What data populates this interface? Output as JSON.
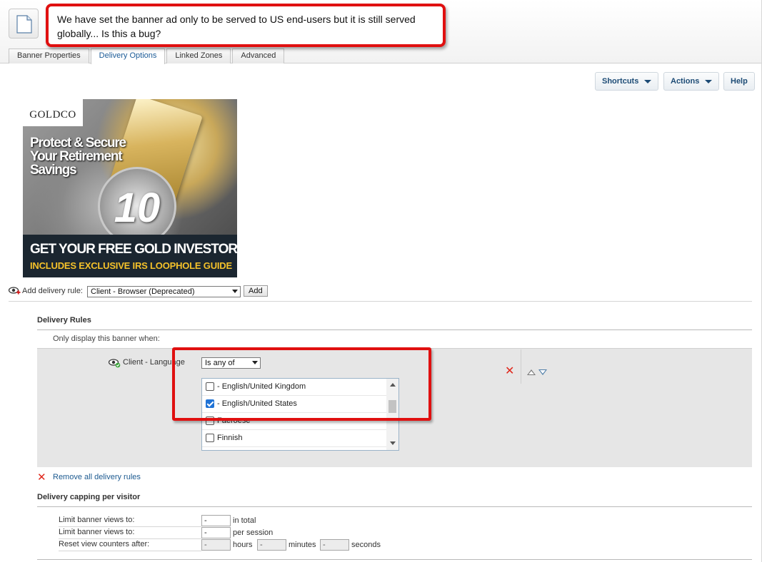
{
  "callout": {
    "text_line1": "We have set the banner ad only to be served to US end-users but it is still served",
    "text_line2": "globally...  Is this a bug?"
  },
  "tabs": [
    {
      "label": "Banner Properties",
      "active": false
    },
    {
      "label": "Delivery Options",
      "active": true
    },
    {
      "label": "Linked Zones",
      "active": false
    },
    {
      "label": "Advanced",
      "active": false
    }
  ],
  "toolbar": {
    "shortcuts_label": "Shortcuts",
    "actions_label": "Actions",
    "help_label": "Help"
  },
  "banner": {
    "brand": "GOLDCO",
    "headline_1": "Protect & Secure",
    "headline_2": "Your Retirement",
    "headline_3": "Savings",
    "cta": "GET YOUR FREE GOLD INVESTOR KIT",
    "subline": "INCLUDES EXCLUSIVE IRS LOOPHOLE GUIDE",
    "coin_number": "10"
  },
  "add_rule": {
    "label": "Add delivery rule:",
    "select_value": "Client - Browser (Deprecated)",
    "button": "Add"
  },
  "delivery_rules": {
    "title": "Delivery Rules",
    "condition_text": "Only display this banner when:",
    "rule": {
      "label": "Client - Language",
      "operator": "Is any of",
      "options": [
        {
          "label": "- English/United Kingdom",
          "checked": false
        },
        {
          "label": "- English/United States",
          "checked": true
        },
        {
          "label": "Faeroese",
          "checked": false
        },
        {
          "label": "Finnish",
          "checked": false
        }
      ]
    },
    "remove_all_label": "Remove all delivery rules"
  },
  "capping": {
    "title": "Delivery capping per visitor",
    "rows": [
      {
        "label": "Limit banner views to:",
        "value": "-",
        "unit": "in total"
      },
      {
        "label": "Limit banner views to:",
        "value": "-",
        "unit": "per session"
      },
      {
        "label": "Reset view counters after:",
        "hours": "-",
        "hours_unit": "hours",
        "minutes": "-",
        "minutes_unit": "minutes",
        "seconds": "-",
        "seconds_unit": "seconds"
      }
    ]
  },
  "colors": {
    "accent_link": "#1c5a90",
    "callout_border": "#e01010",
    "delete_red": "#e0271b"
  }
}
